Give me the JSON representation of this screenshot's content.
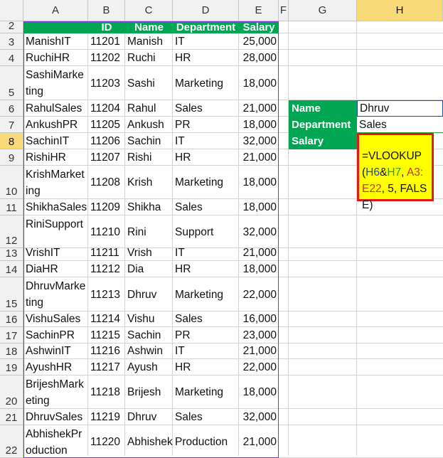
{
  "columns": [
    "A",
    "B",
    "C",
    "D",
    "E",
    "F",
    "G",
    "H"
  ],
  "selected_column": "H",
  "rows": [
    {
      "num": "2",
      "header": true
    },
    {
      "num": "3",
      "fullname": "ManishIT",
      "id": "11201",
      "name": "Manish",
      "dept": "IT",
      "salary": "25,000"
    },
    {
      "num": "4",
      "fullname": "RuchiHR",
      "id": "11202",
      "name": "Ruchi",
      "dept": "HR",
      "salary": "28,000"
    },
    {
      "num": "5",
      "fullname": "SashiMarketing",
      "id": "11203",
      "name": "Sashi",
      "dept": "Marketing",
      "salary": "18,000"
    },
    {
      "num": "6",
      "fullname": "RahulSales",
      "id": "11204",
      "name": "Rahul",
      "dept": "Sales",
      "salary": "21,000"
    },
    {
      "num": "7",
      "fullname": "AnkushPR",
      "id": "11205",
      "name": "Ankush",
      "dept": "PR",
      "salary": "18,000"
    },
    {
      "num": "8",
      "fullname": "SachinIT",
      "id": "11206",
      "name": "Sachin",
      "dept": "IT",
      "salary": "32,000"
    },
    {
      "num": "9",
      "fullname": "RishiHR",
      "id": "11207",
      "name": "Rishi",
      "dept": "HR",
      "salary": "21,000"
    },
    {
      "num": "10",
      "fullname": "KrishMarketing",
      "id": "11208",
      "name": "Krish",
      "dept": "Marketing",
      "salary": "18,000"
    },
    {
      "num": "11",
      "fullname": "ShikhaSales",
      "id": "11209",
      "name": "Shikha",
      "dept": "Sales",
      "salary": "18,000"
    },
    {
      "num": "12",
      "fullname": "RiniSupport",
      "id": "11210",
      "name": "Rini",
      "dept": "Support",
      "salary": "32,000"
    },
    {
      "num": "13",
      "fullname": "VrishIT",
      "id": "11211",
      "name": "Vrish",
      "dept": "IT",
      "salary": "21,000"
    },
    {
      "num": "14",
      "fullname": "DiaHR",
      "id": "11212",
      "name": "Dia",
      "dept": "HR",
      "salary": "18,000"
    },
    {
      "num": "15",
      "fullname": "DhruvMarketing",
      "id": "11213",
      "name": "Dhruv",
      "dept": "Marketing",
      "salary": "22,000"
    },
    {
      "num": "16",
      "fullname": "VishuSales",
      "id": "11214",
      "name": "Vishu",
      "dept": "Sales",
      "salary": "16,000"
    },
    {
      "num": "17",
      "fullname": "SachinPR",
      "id": "11215",
      "name": "Sachin",
      "dept": "PR",
      "salary": "23,000"
    },
    {
      "num": "18",
      "fullname": "AshwinIT",
      "id": "11216",
      "name": "Ashwin",
      "dept": "IT",
      "salary": "21,000"
    },
    {
      "num": "19",
      "fullname": "AyushHR",
      "id": "11217",
      "name": "Ayush",
      "dept": "HR",
      "salary": "22,000"
    },
    {
      "num": "20",
      "fullname": "BrijeshMarketing",
      "id": "11218",
      "name": "Brijesh",
      "dept": "Marketing",
      "salary": "18,000"
    },
    {
      "num": "21",
      "fullname": "DhruvSales",
      "id": "11219",
      "name": "Dhruv",
      "dept": "Sales",
      "salary": "32,000"
    },
    {
      "num": "22",
      "fullname": "AbhishekProduction",
      "id": "11220",
      "name": "Abhishek",
      "dept": "Production",
      "salary": "21,000"
    }
  ],
  "selected_row": "8",
  "table_headers": {
    "id": "ID",
    "name": "Name",
    "dept": "Department",
    "salary": "Salary"
  },
  "lookup": {
    "name_label": "Name",
    "name_value": "Dhruv",
    "dept_label": "Department",
    "dept_value": "Sales",
    "salary_label": "Salary"
  },
  "formula": {
    "prefix": "=VLOOKUP(",
    "ref1": "H6",
    "amp": "&",
    "ref2": "H7",
    "sep1": ", ",
    "ref3": "A3:",
    "ref3b": "E22",
    "tail": ", 5, FALSE)"
  },
  "colors": {
    "green": "#00a651",
    "ref1": "#1f4e9e",
    "ref2": "#2e9e2e",
    "ref3": "#c0392b",
    "formula_bg": "#ffff00",
    "formula_border": "#e0191e"
  }
}
